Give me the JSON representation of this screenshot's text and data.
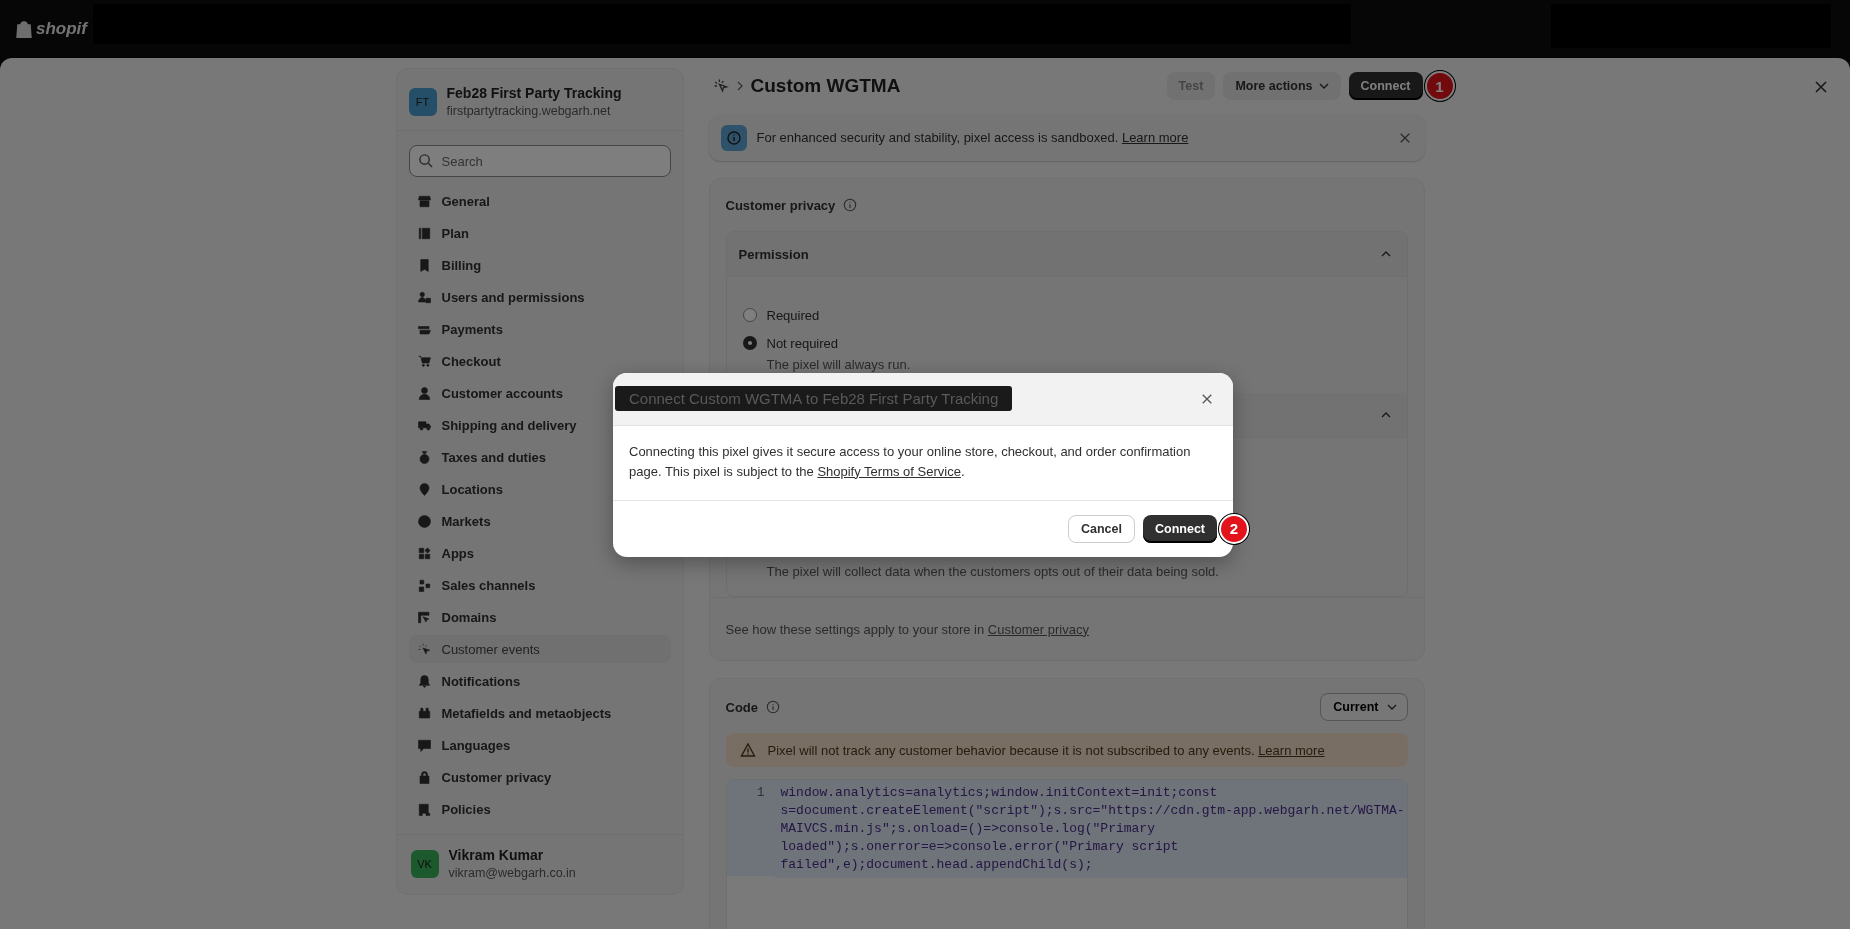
{
  "top_bar": {
    "logo": "shopif"
  },
  "store": {
    "initials": "FT",
    "name": "Feb28 First Party Tracking",
    "domain": "firstpartytracking.webgarh.net"
  },
  "search": {
    "placeholder": "Search"
  },
  "nav": [
    {
      "label": "General",
      "selected": false
    },
    {
      "label": "Plan",
      "selected": false
    },
    {
      "label": "Billing",
      "selected": false
    },
    {
      "label": "Users and permissions",
      "selected": false
    },
    {
      "label": "Payments",
      "selected": false
    },
    {
      "label": "Checkout",
      "selected": false
    },
    {
      "label": "Customer accounts",
      "selected": false
    },
    {
      "label": "Shipping and delivery",
      "selected": false
    },
    {
      "label": "Taxes and duties",
      "selected": false
    },
    {
      "label": "Locations",
      "selected": false
    },
    {
      "label": "Markets",
      "selected": false
    },
    {
      "label": "Apps",
      "selected": false
    },
    {
      "label": "Sales channels",
      "selected": false
    },
    {
      "label": "Domains",
      "selected": false
    },
    {
      "label": "Customer events",
      "selected": true
    },
    {
      "label": "Notifications",
      "selected": false
    },
    {
      "label": "Metafields and metaobjects",
      "selected": false
    },
    {
      "label": "Languages",
      "selected": false
    },
    {
      "label": "Customer privacy",
      "selected": false
    },
    {
      "label": "Policies",
      "selected": false
    }
  ],
  "user": {
    "initials": "VK",
    "name": "Vikram Kumar",
    "email": "vikram@webgarh.co.in"
  },
  "header": {
    "title": "Custom WGTMA",
    "buttons": [
      {
        "label": "Test",
        "kind": "disabled"
      },
      {
        "label": "More actions",
        "kind": "menu"
      },
      {
        "label": "Connect",
        "kind": "primary",
        "marker": "1"
      }
    ]
  },
  "banner": {
    "text": "For enhanced security and stability, pixel access is sandboxed.",
    "link": "Learn more"
  },
  "privacy": {
    "title": "Customer privacy",
    "sections": [
      {
        "title": "Permission",
        "expanded": true,
        "options": [
          {
            "label": "Required",
            "selected": false
          },
          {
            "label": "Not required",
            "selected": true,
            "hint": "The pixel will always run."
          }
        ]
      },
      {
        "expanded": true,
        "note": "The pixel will collect data when the customers opts out of their data being sold."
      }
    ],
    "footer": "See how these settings apply to your store in",
    "footer_link": "Customer privacy"
  },
  "code": {
    "title": "Code",
    "version": "Current",
    "warning": "Pixel will not track any customer behavior because it is not subscribed to any events.",
    "warning_link": "Learn more",
    "line_number": "1",
    "text": "window.analytics=analytics;window.initContext=init;const s=document.createElement(\"script\");s.src=\"https://cdn.gtm-app.webgarh.net/WGTMA-MAIVCS.min.js\";s.onload=()=>console.log(\"Primary loaded\");s.onerror=e=>console.error(\"Primary script failed\",e);document.head.appendChild(s);"
  },
  "modal": {
    "title": "Connect Custom WGTMA to Feb28 First Party Tracking",
    "text": "Connecting this pixel gives it secure access to your online store, checkout, and order confirmation page. This pixel is subject to the",
    "link": "Shopify Terms of Service",
    "text_end": ".",
    "buttons": [
      {
        "label": "Cancel",
        "kind": "secondary"
      },
      {
        "label": "Connect",
        "kind": "primary",
        "marker": "2"
      }
    ]
  }
}
